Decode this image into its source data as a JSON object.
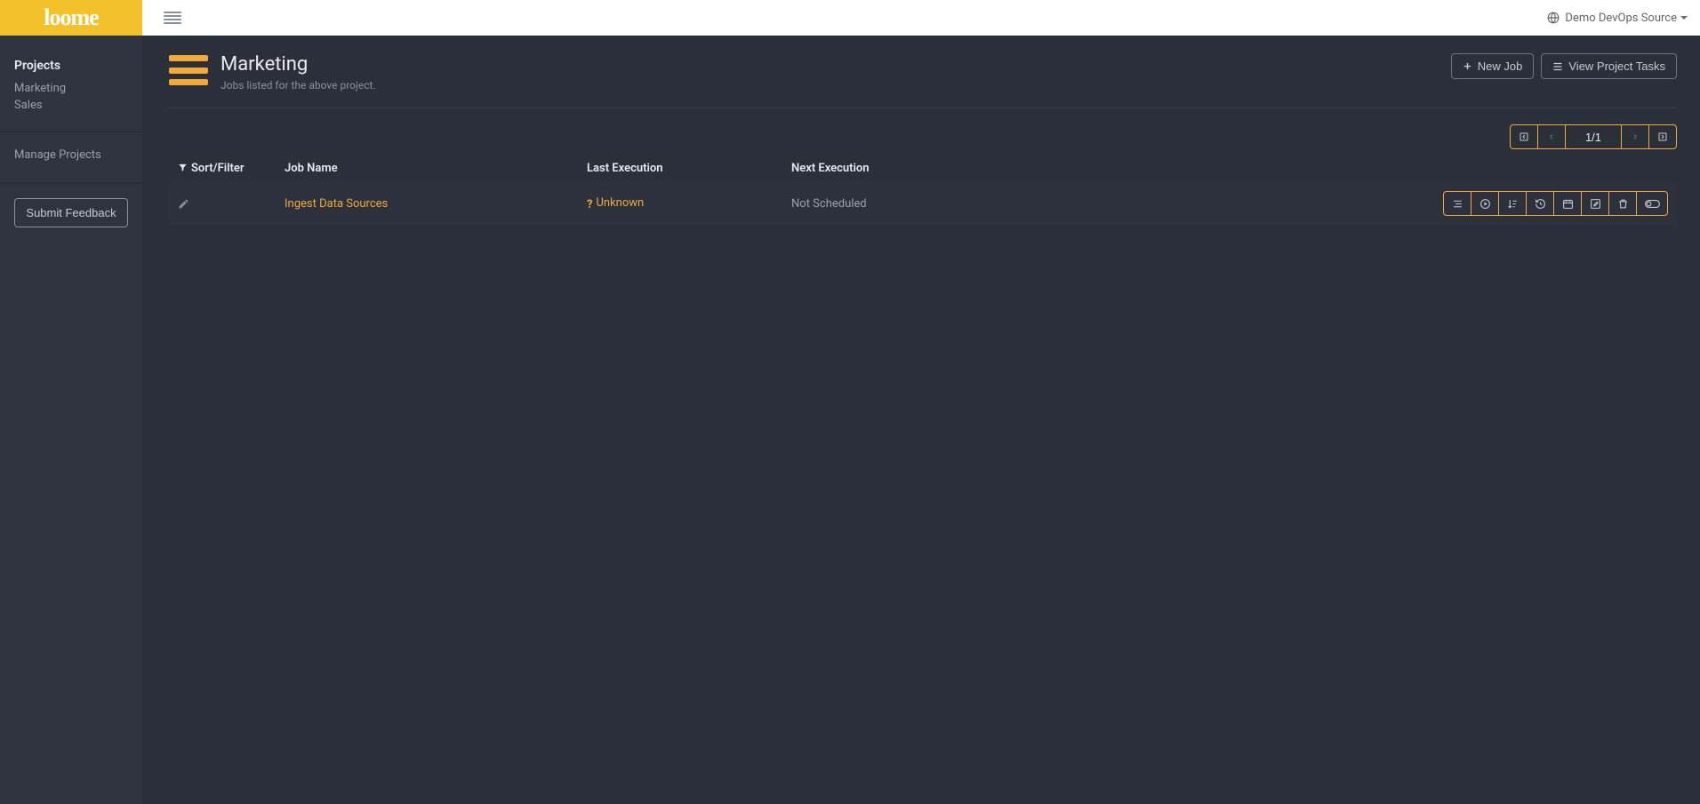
{
  "brand": {
    "name": "loome"
  },
  "topbar": {
    "source_label": "Demo DevOps Source"
  },
  "sidebar": {
    "heading": "Projects",
    "items": [
      {
        "label": "Marketing"
      },
      {
        "label": "Sales"
      }
    ],
    "manage_label": "Manage Projects",
    "feedback_label": "Submit Feedback"
  },
  "page": {
    "title": "Marketing",
    "subtitle": "Jobs listed for the above project.",
    "new_job_label": "New Job",
    "view_tasks_label": "View Project Tasks"
  },
  "pager": {
    "page_display": "1/1"
  },
  "table": {
    "headers": {
      "sort_filter": "Sort/Filter",
      "job_name": "Job Name",
      "last_execution": "Last Execution",
      "next_execution": "Next Execution"
    },
    "rows": [
      {
        "job_name": "Ingest Data Sources",
        "last_execution": "Unknown",
        "next_execution": "Not Scheduled"
      }
    ]
  }
}
